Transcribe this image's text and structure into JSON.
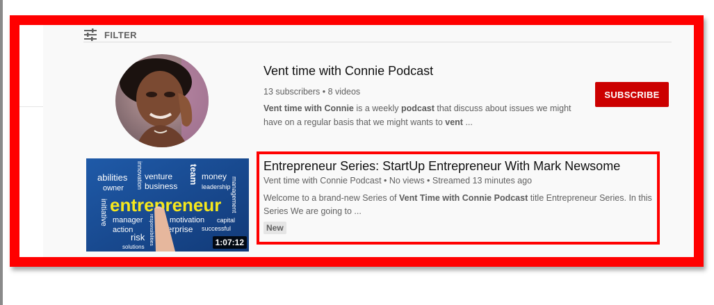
{
  "filter": {
    "label": "FILTER",
    "icon": "filter-sliders-icon"
  },
  "channel": {
    "title": "Vent time with Connie Podcast",
    "meta": "13 subscribers • 8 videos",
    "desc_bold1": "Vent time with Connie",
    "desc_text1": " is a weekly ",
    "desc_bold2": "podcast",
    "desc_text2": " that discuss about issues we might have on a regular basis that we might wants to ",
    "desc_bold3": "vent",
    "desc_text3": " ...",
    "subscribe_label": "SUBSCRIBE",
    "avatar_icon": "channel-avatar-photo"
  },
  "video": {
    "title": "Entrepreneur Series: StartUp Entrepreneur With Mark Newsome",
    "meta": "Vent time with Connie Podcast • No views • Streamed 13 minutes ago",
    "desc_text1": "Welcome to a brand-new Series of ",
    "desc_bold": "Vent Time with Connie Podcast",
    "desc_text2": " title Entrepreneur Series. In this Series We are going to ...",
    "badge": "New",
    "duration": "1:07:12",
    "thumbnail_words": {
      "main": "entrepreneur",
      "w1": "abilities",
      "w2": "owner",
      "w3": "venture",
      "w4": "business",
      "w5": "team",
      "w6": "money",
      "w7": "leadership",
      "w8": "management",
      "w9": "innovation",
      "w10": "initiative",
      "w11": "manager",
      "w12": "action",
      "w13": "risk",
      "w14": "solutions",
      "w15": "motivation",
      "w16": "capital",
      "w17": "enterprise",
      "w18": "successful",
      "w19": "responsibilities"
    }
  },
  "colors": {
    "highlight": "#ff0000",
    "subscribe": "#cc0000",
    "thumbnail_bg": "#1a4d93",
    "keyword": "#f5e71d"
  }
}
